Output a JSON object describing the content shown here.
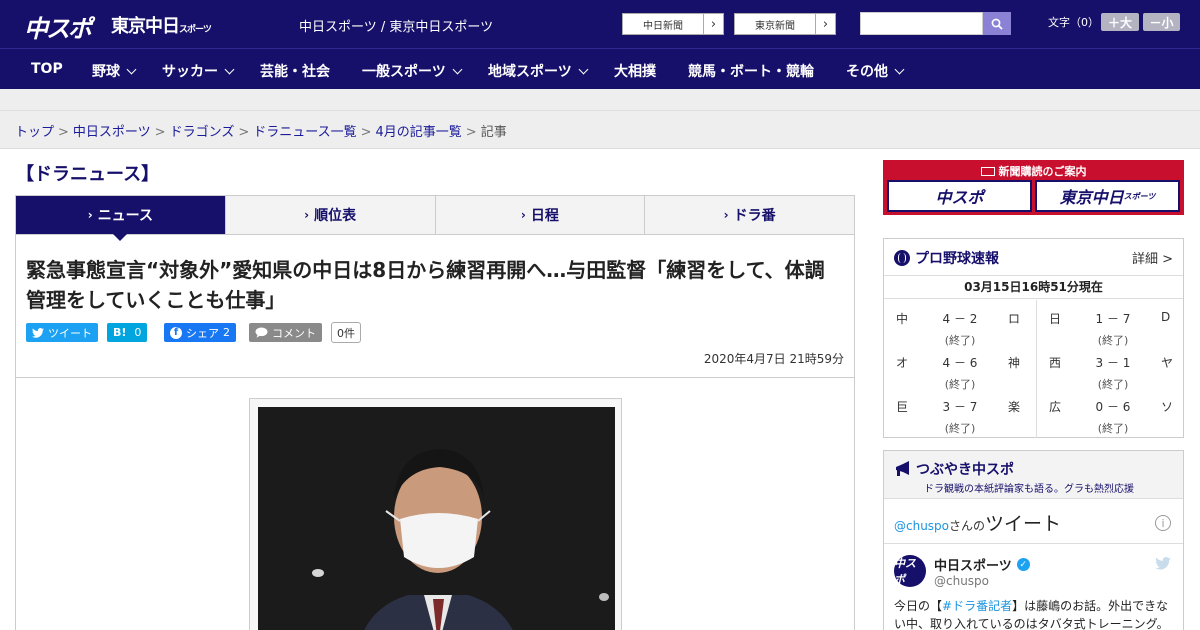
{
  "header": {
    "logo_chuspo": "中スポ",
    "logo_tokyo": "東京中日",
    "logo_tokyo_small": "スポーツ",
    "site_name": "中日スポーツ / 東京中日スポーツ",
    "links": [
      {
        "label": "中日新聞"
      },
      {
        "label": "東京新聞"
      }
    ],
    "search": {
      "value": "",
      "placeholder": ""
    },
    "font_size": {
      "label": "文字（0）",
      "larger": "＋大",
      "smaller": "－小"
    }
  },
  "nav": {
    "items": [
      {
        "label": "TOP",
        "dropdown": false
      },
      {
        "label": "野球",
        "dropdown": true
      },
      {
        "label": "サッカー",
        "dropdown": true
      },
      {
        "label": "芸能・社会",
        "dropdown": false
      },
      {
        "label": "一般スポーツ",
        "dropdown": true
      },
      {
        "label": "地域スポーツ",
        "dropdown": true
      },
      {
        "label": "大相撲",
        "dropdown": false
      },
      {
        "label": "競馬・ボート・競輪",
        "dropdown": false
      },
      {
        "label": "その他",
        "dropdown": true
      }
    ]
  },
  "breadcrumb": {
    "items": [
      "トップ",
      "中日スポーツ",
      "ドラゴンズ",
      "ドラニュース一覧",
      "4月の記事一覧"
    ],
    "current": "記事"
  },
  "section": {
    "title": "【ドラニュース】"
  },
  "tabs": [
    {
      "label": "ニュース",
      "active": true
    },
    {
      "label": "順位表",
      "active": false
    },
    {
      "label": "日程",
      "active": false
    },
    {
      "label": "ドラ番",
      "active": false
    }
  ],
  "article": {
    "headline": "緊急事態宣言“対象外”愛知県の中日は8日から練習再開へ…与田監督「練習をして、体調管理をしていくことも仕事」",
    "share": {
      "tweet": "ツイート",
      "hatena": "B!",
      "hatena_count": "0",
      "facebook": "シェア",
      "facebook_count": "2",
      "comment": "コメント",
      "comment_count": "0件"
    },
    "date": "2020年4月7日 21時59分"
  },
  "sidebar": {
    "subscription": {
      "heading": "新聞購読のご案内",
      "chuspo": "中スポ",
      "tokyo": "東京中日",
      "tokyo_small": "スポーツ"
    },
    "scores": {
      "title": "プロ野球速報",
      "detail": "詳細 >",
      "updated": "03月15日16時51分現在",
      "games": [
        {
          "home": "中",
          "score": "4 － 2",
          "away": "ロ",
          "status": "(終了)"
        },
        {
          "home": "日",
          "score": "1 － 7",
          "away": "D",
          "status": "(終了)"
        },
        {
          "home": "オ",
          "score": "4 － 6",
          "away": "神",
          "status": "(終了)"
        },
        {
          "home": "西",
          "score": "3 － 1",
          "away": "ヤ",
          "status": "(終了)"
        },
        {
          "home": "巨",
          "score": "3 － 7",
          "away": "楽",
          "status": "(終了)"
        },
        {
          "home": "広",
          "score": "0 － 6",
          "away": "ソ",
          "status": "(終了)"
        }
      ]
    },
    "tweets": {
      "title": "つぶやき中スポ",
      "subtitle": "ドラ観戦の本紙評論家も語る。グラも熱烈応援",
      "handle": "@chuspo",
      "handle_suffix": "さんの",
      "big_label": "ツイート",
      "info": "i",
      "avatar_text": "中スポ",
      "author": "中日スポーツ",
      "author_handle": "@chuspo",
      "text_pre": "今日の【",
      "text_tag": "#ドラ番記者",
      "text_post": "】は藤嶋のお話。外出できない中、取り入れているのはタバタ式トレーニング。"
    }
  }
}
